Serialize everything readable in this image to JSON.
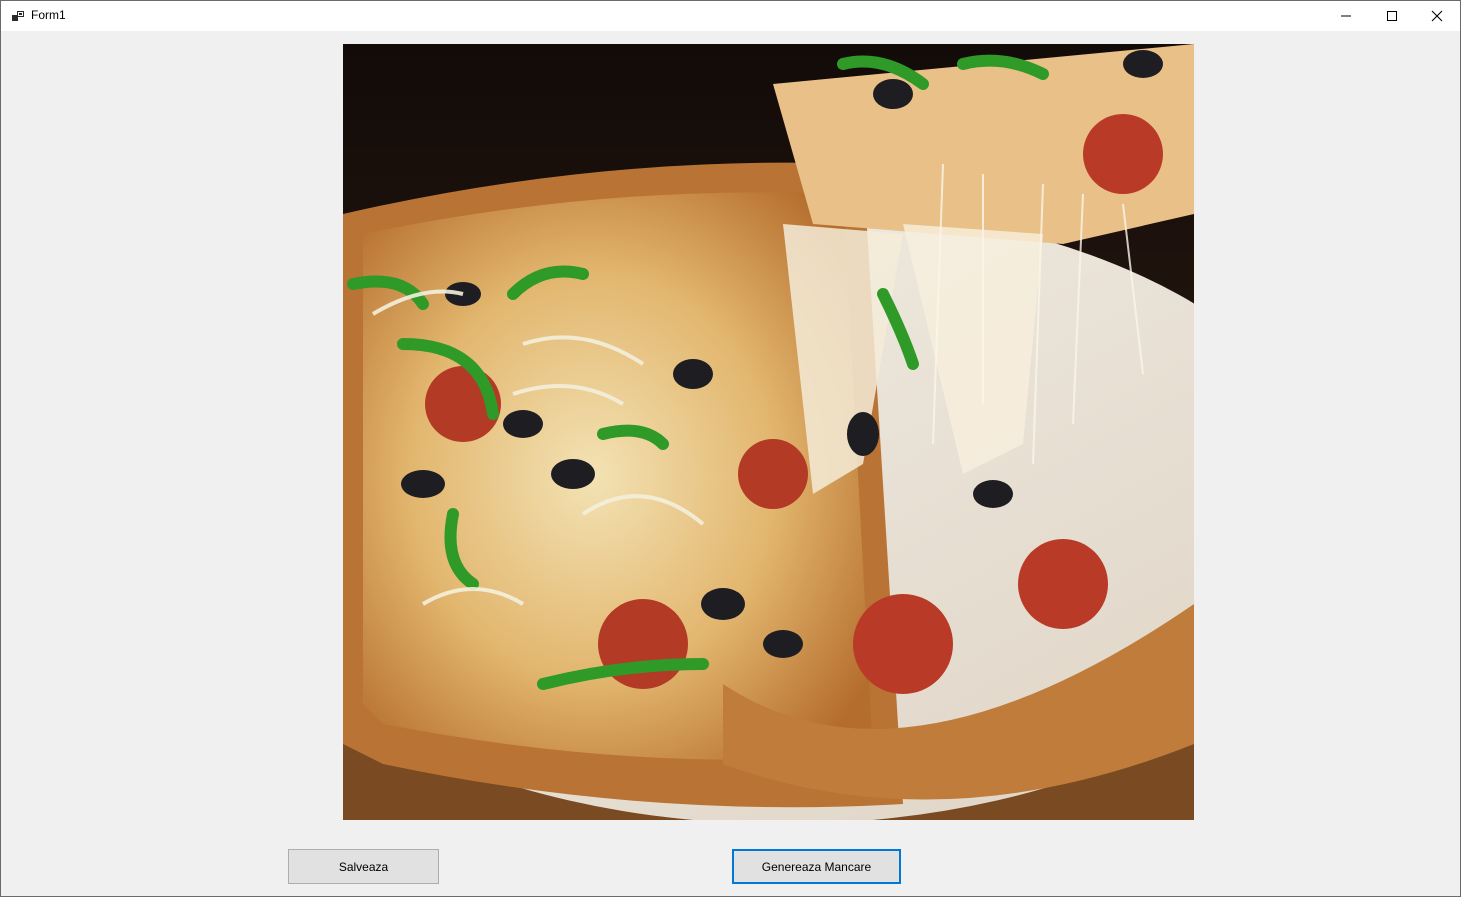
{
  "window": {
    "title": "Form1",
    "controls": {
      "minimize_icon": "minimize-icon",
      "maximize_icon": "maximize-icon",
      "close_icon": "close-icon"
    }
  },
  "picture": {
    "icon": "pizza-photo",
    "subject": "pizza"
  },
  "buttons": {
    "save_label": "Salveaza",
    "generate_label": "Genereaza Mancare"
  },
  "colors": {
    "form_background": "#f0f0f0",
    "focus_border": "#0078d7",
    "button_face": "#e1e1e1"
  }
}
